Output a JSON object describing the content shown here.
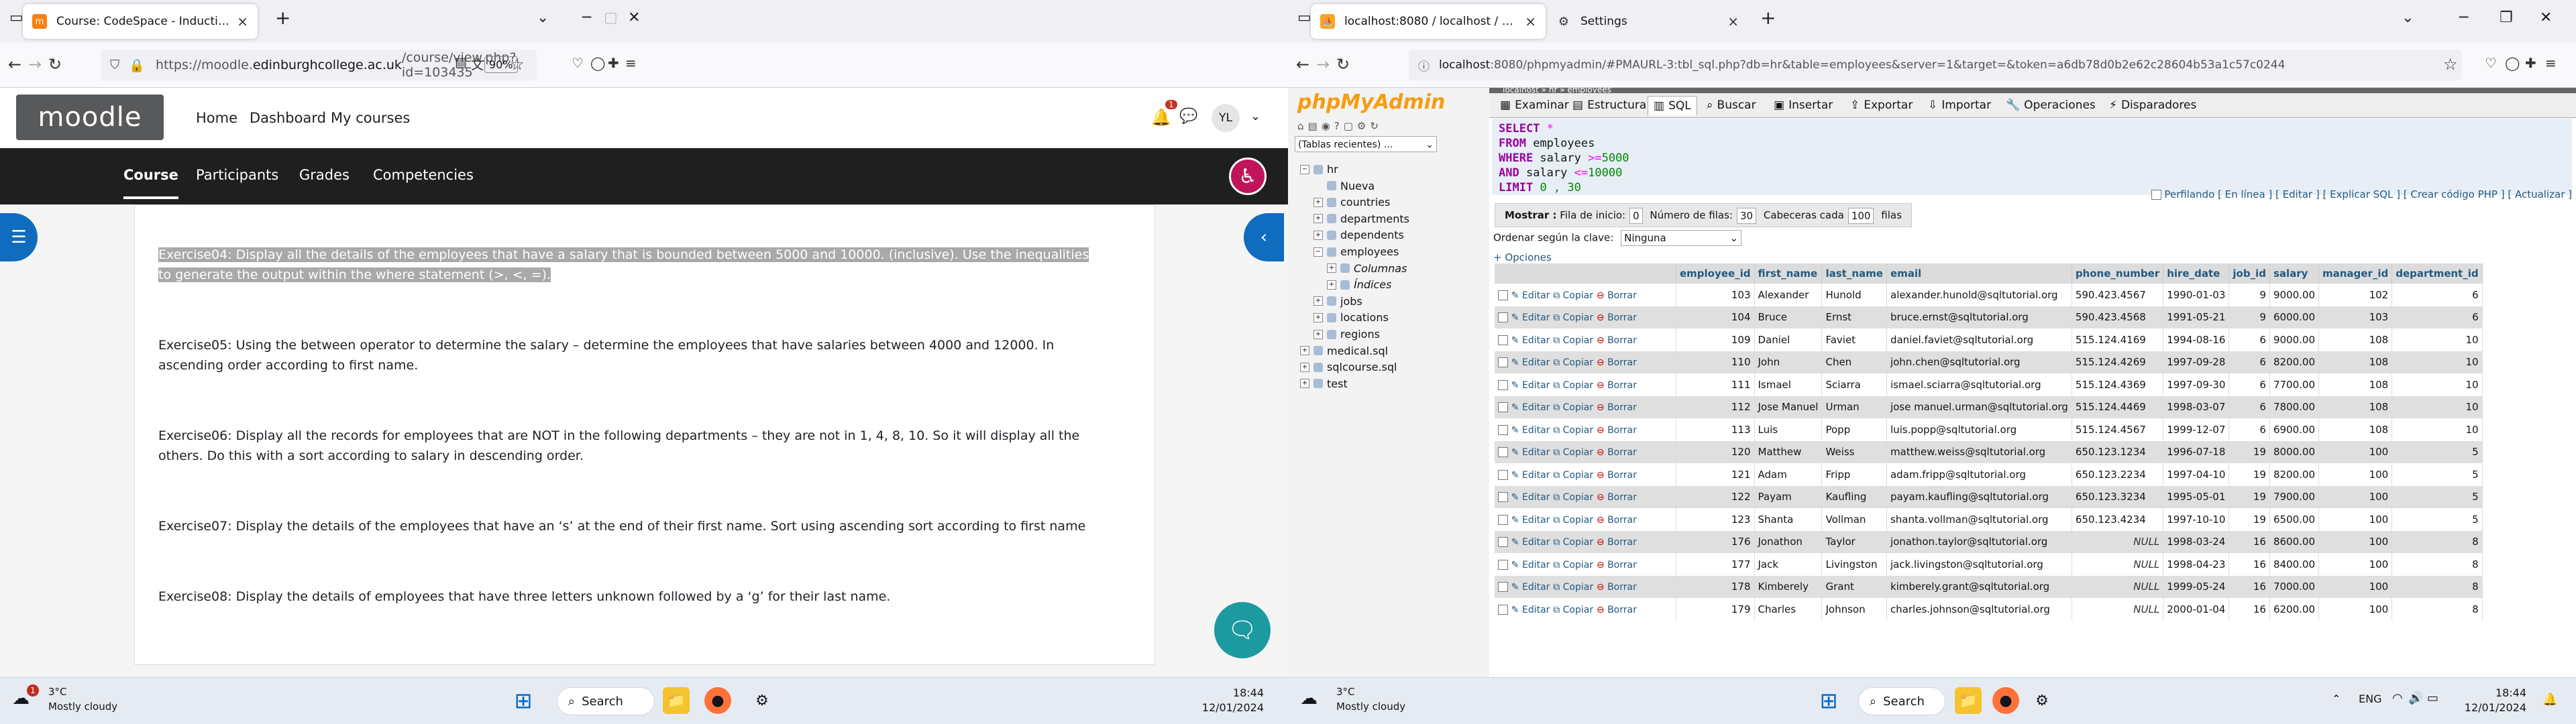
{
  "left": {
    "browser": {
      "tabs": [
        {
          "title": "Course: CodeSpace - Induction"
        }
      ],
      "url_prefix": "https://moodle.",
      "url_domain": "edinburghcollege.ac.uk",
      "url_path": "/course/view.php?id=103435",
      "zoom": "90%"
    },
    "moodle": {
      "logo_text": "moodle",
      "nav": [
        "Home",
        "Dashboard",
        "My courses"
      ],
      "notification_count": "1",
      "user_initials": "YL",
      "secondary_nav": [
        "Course",
        "Participants",
        "Grades",
        "Competencies"
      ],
      "exercises": [
        {
          "id": "ex04",
          "text": "Exercise04: Display all the details of the employees that have a salary that is bounded between 5000 and 10000. (inclusive). Use the inequalities to generate the output within the where statement (>, <, =)."
        },
        {
          "id": "ex05",
          "text": "Exercise05: Using the between operator to determine the salary – determine the employees that have salaries between 4000 and 12000. In ascending order according to first name."
        },
        {
          "id": "ex06",
          "text": "Exercise06: Display all the records for employees that are NOT in the following departments – they are not in 1, 4, 8, 10. So it will display all the others. Do this with a sort according to salary in descending order."
        },
        {
          "id": "ex07",
          "text": "Exercise07: Display the details of the employees that have an ‘s’ at the end of their first name. Sort using ascending sort according to first name"
        },
        {
          "id": "ex08",
          "text": "Exercise08: Display the details of employees that have three letters unknown followed by a ‘g’  for their last name."
        }
      ]
    },
    "taskbar": {
      "weather_badge": "1",
      "temp": "3°C",
      "weather": "Mostly cloudy",
      "search": "Search",
      "time": "18:44",
      "date": "12/01/2024"
    }
  },
  "right": {
    "browser": {
      "tabs": [
        {
          "title": "localhost:8080 / localhost / hr /"
        },
        {
          "title": "Settings"
        }
      ],
      "url_prefix": "localhost",
      "url_rest": ":8080/phpmyadmin/#PMAURL-3:tbl_sql.php?db=hr&table=employees&server=1&target=&token=a6db78d0b2e62c28604b53a1c57c0244"
    },
    "pma": {
      "logo": "phpMyAdmin",
      "recent_tables": "(Tablas recientes) ...",
      "breadcrumb": "localhost » hr » employees",
      "tree": [
        {
          "label": "hr",
          "level": 0,
          "toggle": "−"
        },
        {
          "label": "Nueva",
          "level": 1,
          "toggle": ""
        },
        {
          "label": "countries",
          "level": 1,
          "toggle": "+"
        },
        {
          "label": "departments",
          "level": 1,
          "toggle": "+"
        },
        {
          "label": "dependents",
          "level": 1,
          "toggle": "+"
        },
        {
          "label": "employees",
          "level": 1,
          "toggle": "−"
        },
        {
          "label": "Columnas",
          "level": 2,
          "toggle": "+"
        },
        {
          "label": "Índices",
          "level": 2,
          "toggle": "+"
        },
        {
          "label": "jobs",
          "level": 1,
          "toggle": "+"
        },
        {
          "label": "locations",
          "level": 1,
          "toggle": "+"
        },
        {
          "label": "regions",
          "level": 1,
          "toggle": "+"
        },
        {
          "label": "medical.sql",
          "level": 0,
          "toggle": "+"
        },
        {
          "label": "sqlcourse.sql",
          "level": 0,
          "toggle": "+"
        },
        {
          "label": "test",
          "level": 0,
          "toggle": "+"
        }
      ],
      "tabs": [
        "Examinar",
        "Estructura",
        "SQL",
        "Buscar",
        "Insertar",
        "Exportar",
        "Importar",
        "Operaciones",
        "Disparadores"
      ],
      "sql": {
        "select": "SELECT",
        "star": "*",
        "from": "FROM",
        "table": "employees",
        "where": "WHERE",
        "col1": "salary",
        "op1": ">=",
        "v1": "5000",
        "and": "AND",
        "col2": "salary",
        "op2": "<=",
        "v2": "10000",
        "limit": "LIMIT",
        "lim": "0 , 30"
      },
      "query_links": "Perfilando [ En línea ] [ Editar ] [ Explicar SQL ] [ Crear código PHP ] [ Actualizar ]",
      "show": {
        "label": "Mostrar :",
        "start_label": "Fila de inicio:",
        "start": "0",
        "rows_label": "Número de filas:",
        "rows": "30",
        "headers_label": "Cabeceras cada",
        "headers": "100",
        "suffix": "filas"
      },
      "sort_label": "Ordenar según la clave:",
      "sort_value": "Ninguna",
      "options": "+ Opciones",
      "actions": {
        "edit": "Editar",
        "copy": "Copiar",
        "delete": "Borrar"
      },
      "columns": [
        "employee_id",
        "first_name",
        "last_name",
        "email",
        "phone_number",
        "hire_date",
        "job_id",
        "salary",
        "manager_id",
        "department_id"
      ],
      "rows": [
        [
          "103",
          "Alexander",
          "Hunold",
          "alexander.hunold@sqltutorial.org",
          "590.423.4567",
          "1990-01-03",
          "9",
          "9000.00",
          "102",
          "6"
        ],
        [
          "104",
          "Bruce",
          "Ernst",
          "bruce.ernst@sqltutorial.org",
          "590.423.4568",
          "1991-05-21",
          "9",
          "6000.00",
          "103",
          "6"
        ],
        [
          "109",
          "Daniel",
          "Faviet",
          "daniel.faviet@sqltutorial.org",
          "515.124.4169",
          "1994-08-16",
          "6",
          "9000.00",
          "108",
          "10"
        ],
        [
          "110",
          "John",
          "Chen",
          "john.chen@sqltutorial.org",
          "515.124.4269",
          "1997-09-28",
          "6",
          "8200.00",
          "108",
          "10"
        ],
        [
          "111",
          "Ismael",
          "Sciarra",
          "ismael.sciarra@sqltutorial.org",
          "515.124.4369",
          "1997-09-30",
          "6",
          "7700.00",
          "108",
          "10"
        ],
        [
          "112",
          "Jose Manuel",
          "Urman",
          "jose manuel.urman@sqltutorial.org",
          "515.124.4469",
          "1998-03-07",
          "6",
          "7800.00",
          "108",
          "10"
        ],
        [
          "113",
          "Luis",
          "Popp",
          "luis.popp@sqltutorial.org",
          "515.124.4567",
          "1999-12-07",
          "6",
          "6900.00",
          "108",
          "10"
        ],
        [
          "120",
          "Matthew",
          "Weiss",
          "matthew.weiss@sqltutorial.org",
          "650.123.1234",
          "1996-07-18",
          "19",
          "8000.00",
          "100",
          "5"
        ],
        [
          "121",
          "Adam",
          "Fripp",
          "adam.fripp@sqltutorial.org",
          "650.123.2234",
          "1997-04-10",
          "19",
          "8200.00",
          "100",
          "5"
        ],
        [
          "122",
          "Payam",
          "Kaufling",
          "payam.kaufling@sqltutorial.org",
          "650.123.3234",
          "1995-05-01",
          "19",
          "7900.00",
          "100",
          "5"
        ],
        [
          "123",
          "Shanta",
          "Vollman",
          "shanta.vollman@sqltutorial.org",
          "650.123.4234",
          "1997-10-10",
          "19",
          "6500.00",
          "100",
          "5"
        ],
        [
          "176",
          "Jonathon",
          "Taylor",
          "jonathon.taylor@sqltutorial.org",
          "NULL",
          "1998-03-24",
          "16",
          "8600.00",
          "100",
          "8"
        ],
        [
          "177",
          "Jack",
          "Livingston",
          "jack.livingston@sqltutorial.org",
          "NULL",
          "1998-04-23",
          "16",
          "8400.00",
          "100",
          "8"
        ],
        [
          "178",
          "Kimberely",
          "Grant",
          "kimberely.grant@sqltutorial.org",
          "NULL",
          "1999-05-24",
          "16",
          "7000.00",
          "100",
          "8"
        ],
        [
          "179",
          "Charles",
          "Johnson",
          "charles.johnson@sqltutorial.org",
          "NULL",
          "2000-01-04",
          "16",
          "6200.00",
          "100",
          "8"
        ]
      ]
    },
    "taskbar": {
      "temp": "3°C",
      "weather": "Mostly cloudy",
      "search": "Search",
      "lang": "ENG",
      "time": "18:44",
      "date": "12/01/2024"
    }
  }
}
